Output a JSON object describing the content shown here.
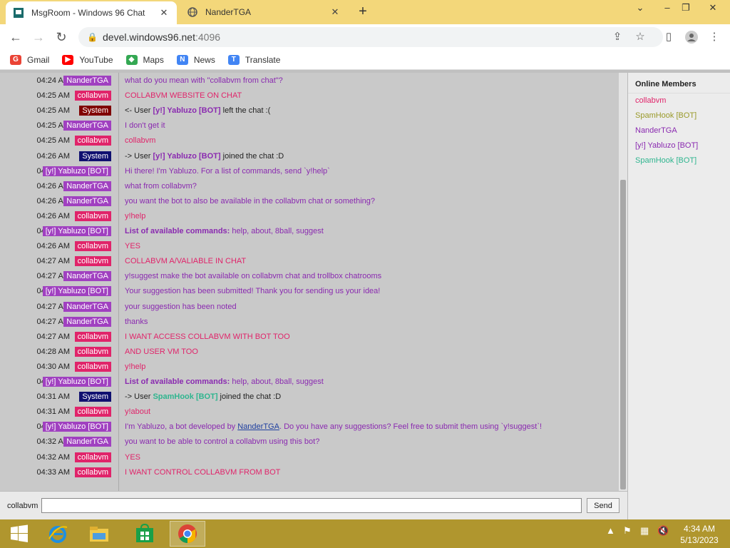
{
  "browser": {
    "tabs": [
      {
        "title": "MsgRoom - Windows 96 Chat",
        "active": true
      },
      {
        "title": "NanderTGA",
        "active": false
      }
    ],
    "url_host": "devel.windows96.net",
    "url_port": ":4096",
    "bookmarks": [
      {
        "label": "Gmail",
        "icon": "G",
        "color": "#ea4335"
      },
      {
        "label": "YouTube",
        "icon": "▶",
        "color": "#ff0000"
      },
      {
        "label": "Maps",
        "icon": "◆",
        "color": "#34a853"
      },
      {
        "label": "News",
        "icon": "N",
        "color": "#4285f4"
      },
      {
        "label": "Translate",
        "icon": "T",
        "color": "#4285f4"
      }
    ]
  },
  "chat": {
    "messages": [
      {
        "time": "04:24 AM",
        "user": "NanderTGA",
        "ucls": "u-nander",
        "tcls": "c-nander",
        "text": "what do you mean with \"collabvm from chat\"?"
      },
      {
        "time": "04:25 AM",
        "user": "collabvm",
        "ucls": "u-collab",
        "tcls": "c-collab",
        "text": "COLLABVM WEBSITE ON CHAT"
      },
      {
        "time": "04:25 AM",
        "user": "System",
        "ucls": "u-system",
        "tcls": "c-sys",
        "pre": "<- User ",
        "bold": "[y!] Yabluzo [BOT]",
        "boldcls": "c-yab",
        "post": " left the chat :("
      },
      {
        "time": "04:25 AM",
        "user": "NanderTGA",
        "ucls": "u-nander",
        "tcls": "c-nander",
        "text": "I don't get it"
      },
      {
        "time": "04:25 AM",
        "user": "collabvm",
        "ucls": "u-collab",
        "tcls": "c-collab",
        "text": "collabvm"
      },
      {
        "time": "04:26 AM",
        "user": "System",
        "ucls": "u-system2",
        "tcls": "c-sys",
        "pre": "-> User ",
        "bold": "[y!] Yabluzo [BOT]",
        "boldcls": "c-yab",
        "post": " joined the chat :D"
      },
      {
        "time": "04:26 AM",
        "user": "[y!] Yabluzo [BOT]",
        "ucls": "u-yab",
        "tcls": "c-yab",
        "text": "Hi there! I'm Yabluzo. For a list of commands, send `y!help`"
      },
      {
        "time": "04:26 AM",
        "user": "NanderTGA",
        "ucls": "u-nander",
        "tcls": "c-nander",
        "text": "what from collabvm?"
      },
      {
        "time": "04:26 AM",
        "user": "NanderTGA",
        "ucls": "u-nander",
        "tcls": "c-nander",
        "text": "you want the bot to also be available in the collabvm chat or something?"
      },
      {
        "time": "04:26 AM",
        "user": "collabvm",
        "ucls": "u-collab",
        "tcls": "c-collab",
        "text": "y!help"
      },
      {
        "time": "04:26 AM",
        "user": "[y!] Yabluzo [BOT]",
        "ucls": "u-yab",
        "tcls": "c-yab",
        "pre": "",
        "bold": "List of available commands:",
        "boldcls": "c-yab",
        "post": " help, about, 8ball, suggest"
      },
      {
        "time": "04:26 AM",
        "user": "collabvm",
        "ucls": "u-collab",
        "tcls": "c-collab",
        "text": "YES"
      },
      {
        "time": "04:27 AM",
        "user": "collabvm",
        "ucls": "u-collab",
        "tcls": "c-collab",
        "text": "COLLABVM A/VALIABLE IN CHAT"
      },
      {
        "time": "04:27 AM",
        "user": "NanderTGA",
        "ucls": "u-nander",
        "tcls": "c-nander",
        "text": "y!suggest make the bot available on collabvm chat and trollbox chatrooms"
      },
      {
        "time": "04:27 AM",
        "user": "[y!] Yabluzo [BOT]",
        "ucls": "u-yab",
        "tcls": "c-yab",
        "text": "Your suggestion has been submitted! Thank you for sending us your idea!"
      },
      {
        "time": "04:27 AM",
        "user": "NanderTGA",
        "ucls": "u-nander",
        "tcls": "c-nander",
        "text": "your suggestion has been noted"
      },
      {
        "time": "04:27 AM",
        "user": "NanderTGA",
        "ucls": "u-nander",
        "tcls": "c-nander",
        "text": "thanks"
      },
      {
        "time": "04:27 AM",
        "user": "collabvm",
        "ucls": "u-collab",
        "tcls": "c-collab",
        "text": "I WANT ACCESS COLLABVM WITH BOT TOO"
      },
      {
        "time": "04:28 AM",
        "user": "collabvm",
        "ucls": "u-collab",
        "tcls": "c-collab",
        "text": "AND USER VM TOO"
      },
      {
        "time": "04:30 AM",
        "user": "collabvm",
        "ucls": "u-collab",
        "tcls": "c-collab",
        "text": "y!help"
      },
      {
        "time": "04:30 AM",
        "user": "[y!] Yabluzo [BOT]",
        "ucls": "u-yab",
        "tcls": "c-yab",
        "pre": "",
        "bold": "List of available commands:",
        "boldcls": "c-yab",
        "post": " help, about, 8ball, suggest"
      },
      {
        "time": "04:31 AM",
        "user": "System",
        "ucls": "u-system2",
        "tcls": "c-sys",
        "pre": "-> User ",
        "bold": "SpamHook [BOT]",
        "boldcls": "spam",
        "post": " joined the chat :D"
      },
      {
        "time": "04:31 AM",
        "user": "collabvm",
        "ucls": "u-collab",
        "tcls": "c-collab",
        "text": "y!about"
      },
      {
        "time": "04:31 AM",
        "user": "[y!] Yabluzo [BOT]",
        "ucls": "u-yab",
        "tcls": "c-yab",
        "pre": "I'm Yabluzo, a bot developed by ",
        "link": "NanderTGA",
        "post": ". Do you have any suggestions? Feel free to submit them using `y!suggest`!"
      },
      {
        "time": "04:32 AM",
        "user": "NanderTGA",
        "ucls": "u-nander",
        "tcls": "c-nander",
        "text": "you want to be able to control a collabvm using this bot?"
      },
      {
        "time": "04:32 AM",
        "user": "collabvm",
        "ucls": "u-collab",
        "tcls": "c-collab",
        "text": "YES"
      },
      {
        "time": "04:33 AM",
        "user": "collabvm",
        "ucls": "u-collab",
        "tcls": "c-collab",
        "text": "I WANT CONTROL COLLABVM FROM BOT"
      }
    ],
    "nickname": "collabvm",
    "input_value": "",
    "send_label": "Send"
  },
  "members": {
    "title": "Online Members",
    "list": [
      {
        "name": "collabvm",
        "color": "#e0246a"
      },
      {
        "name": "SpamHook [BOT]",
        "color": "#9a9a2a"
      },
      {
        "name": "NanderTGA",
        "color": "#8a2ab0"
      },
      {
        "name": "[y!] Yabluzo [BOT]",
        "color": "#8a2ab0"
      },
      {
        "name": "SpamHook [BOT]",
        "color": "#2fb58f"
      }
    ]
  },
  "taskbar": {
    "time": "4:34 AM",
    "date": "5/13/2023"
  }
}
